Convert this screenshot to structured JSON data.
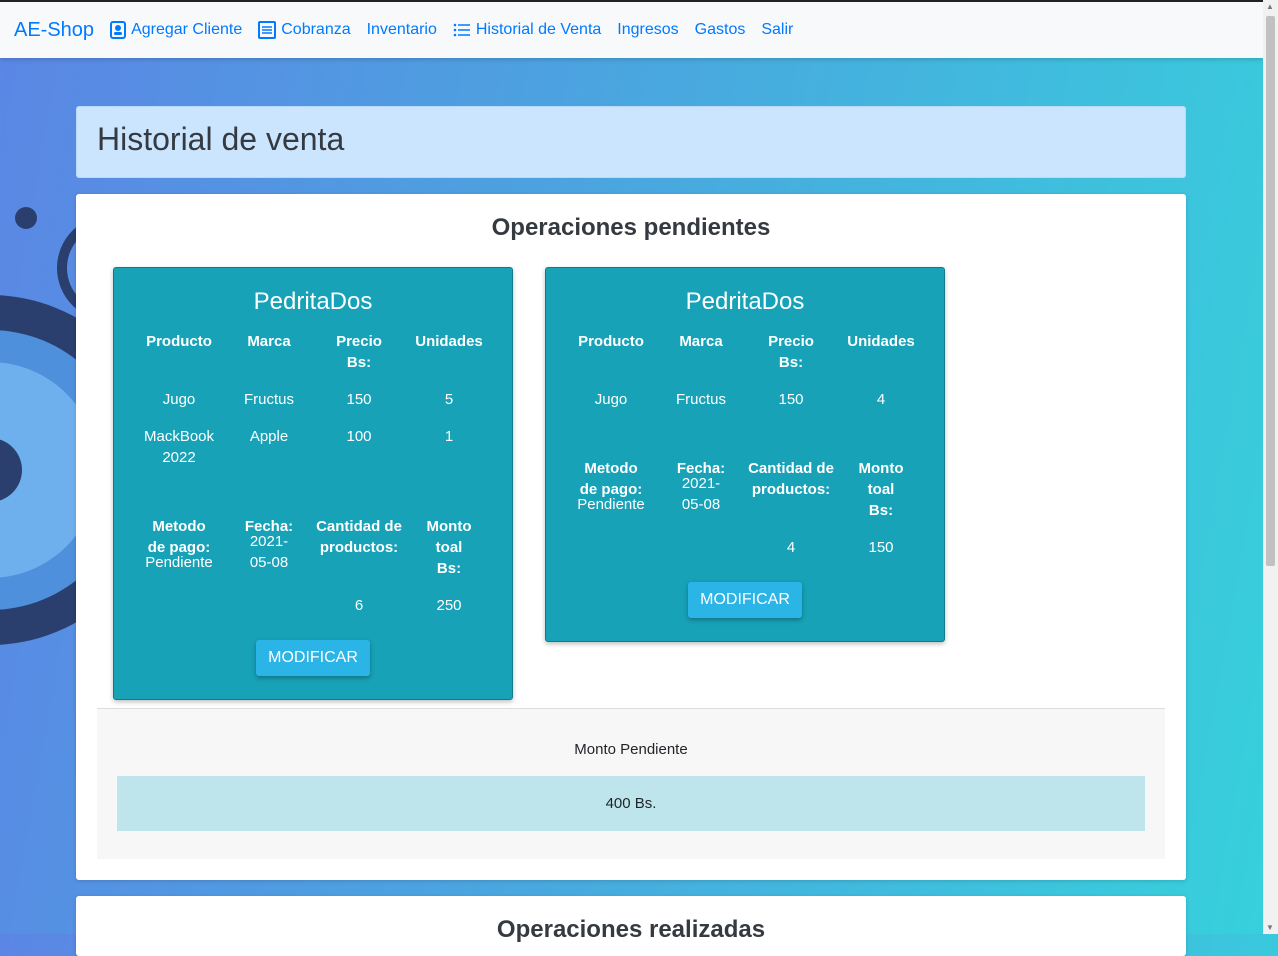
{
  "nav": {
    "brand": "AE-Shop",
    "items": [
      {
        "label": "Agregar Cliente",
        "icon": "person-badge-icon"
      },
      {
        "label": "Cobranza",
        "icon": "receipt-icon"
      },
      {
        "label": "Inventario"
      },
      {
        "label": "Historial de Venta",
        "icon": "list-icon"
      },
      {
        "label": "Ingresos"
      },
      {
        "label": "Gastos"
      },
      {
        "label": "Salir"
      }
    ]
  },
  "page": {
    "title": "Historial de venta"
  },
  "pending": {
    "title": "Operaciones pendientes",
    "headers": {
      "product": "Producto",
      "brand": "Marca",
      "price": "Precio Bs:",
      "units": "Unidades"
    },
    "summary_headers": {
      "method": "Metodo de pago:",
      "date": "Fecha:",
      "quantity": "Cantidad de productos:",
      "total": "Monto toal Bs:"
    },
    "button_label": "MODIFICAR",
    "cards": [
      {
        "client": "PedritaDos",
        "rows": [
          {
            "product": "Jugo",
            "brand": "Fructus",
            "price": "150",
            "units": "5"
          },
          {
            "product": "MackBook 2022",
            "brand": "Apple",
            "price": "100",
            "units": "1"
          }
        ],
        "method": "Pendiente",
        "date": "2021-05-08",
        "quantity": "6",
        "total": "250"
      },
      {
        "client": "PedritaDos",
        "rows": [
          {
            "product": "Jugo",
            "brand": "Fructus",
            "price": "150",
            "units": "4"
          }
        ],
        "method": "Pendiente",
        "date": "2021-05-08",
        "quantity": "4",
        "total": "150"
      }
    ],
    "footer": {
      "label": "Monto Pendiente",
      "amount": "400 Bs."
    }
  },
  "done": {
    "title": "Operaciones realizadas"
  },
  "colors": {
    "accent": "#007bff",
    "card": "#17a2b8",
    "button": "#2bb4e6",
    "alert": "#cce5ff",
    "amount_bg": "#bee5eb"
  }
}
